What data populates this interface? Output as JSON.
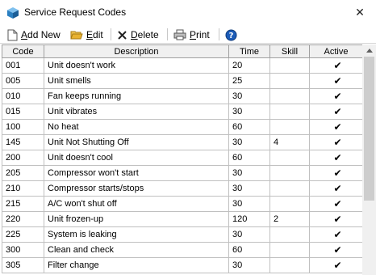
{
  "window": {
    "title": "Service Request Codes",
    "close_glyph": "✕"
  },
  "toolbar": {
    "add_new": {
      "accel": "A",
      "rest": "dd New"
    },
    "edit": {
      "accel": "E",
      "rest": "dit"
    },
    "delete": {
      "accel": "D",
      "rest": "elete"
    },
    "print": {
      "accel": "P",
      "rest": "rint"
    }
  },
  "grid": {
    "columns": [
      "Code",
      "Description",
      "Time",
      "Skill",
      "Active"
    ],
    "rows": [
      {
        "code": "001",
        "description": "Unit doesn't work",
        "time": "20",
        "skill": "",
        "active": "✔"
      },
      {
        "code": "005",
        "description": "Unit smells",
        "time": "25",
        "skill": "",
        "active": "✔"
      },
      {
        "code": "010",
        "description": "Fan keeps running",
        "time": "30",
        "skill": "",
        "active": "✔"
      },
      {
        "code": "015",
        "description": "Unit vibrates",
        "time": "30",
        "skill": "",
        "active": "✔"
      },
      {
        "code": "100",
        "description": "No heat",
        "time": "60",
        "skill": "",
        "active": "✔"
      },
      {
        "code": "145",
        "description": "Unit Not Shutting Off",
        "time": "30",
        "skill": "4",
        "active": "✔"
      },
      {
        "code": "200",
        "description": "Unit doesn't cool",
        "time": "60",
        "skill": "",
        "active": "✔"
      },
      {
        "code": "205",
        "description": "Compressor won't start",
        "time": "30",
        "skill": "",
        "active": "✔"
      },
      {
        "code": "210",
        "description": "Compressor starts/stops",
        "time": "30",
        "skill": "",
        "active": "✔"
      },
      {
        "code": "215",
        "description": "A/C won't shut off",
        "time": "30",
        "skill": "",
        "active": "✔"
      },
      {
        "code": "220",
        "description": "Unit frozen-up",
        "time": "120",
        "skill": "2",
        "active": "✔"
      },
      {
        "code": "225",
        "description": "System is leaking",
        "time": "30",
        "skill": "",
        "active": "✔"
      },
      {
        "code": "300",
        "description": "Clean and check",
        "time": "60",
        "skill": "",
        "active": "✔"
      },
      {
        "code": "305",
        "description": "Filter change",
        "time": "30",
        "skill": "",
        "active": "✔"
      }
    ]
  },
  "icons": {
    "app": "cube-icon",
    "add_new": "new-document-icon",
    "edit": "open-folder-icon",
    "delete": "delete-x-icon",
    "print": "printer-icon",
    "help": "help-icon"
  },
  "colors": {
    "app_icon": "#2a7fc1",
    "folder": "#e8b230",
    "delete": "#222222",
    "help": "#1c5cb8"
  }
}
